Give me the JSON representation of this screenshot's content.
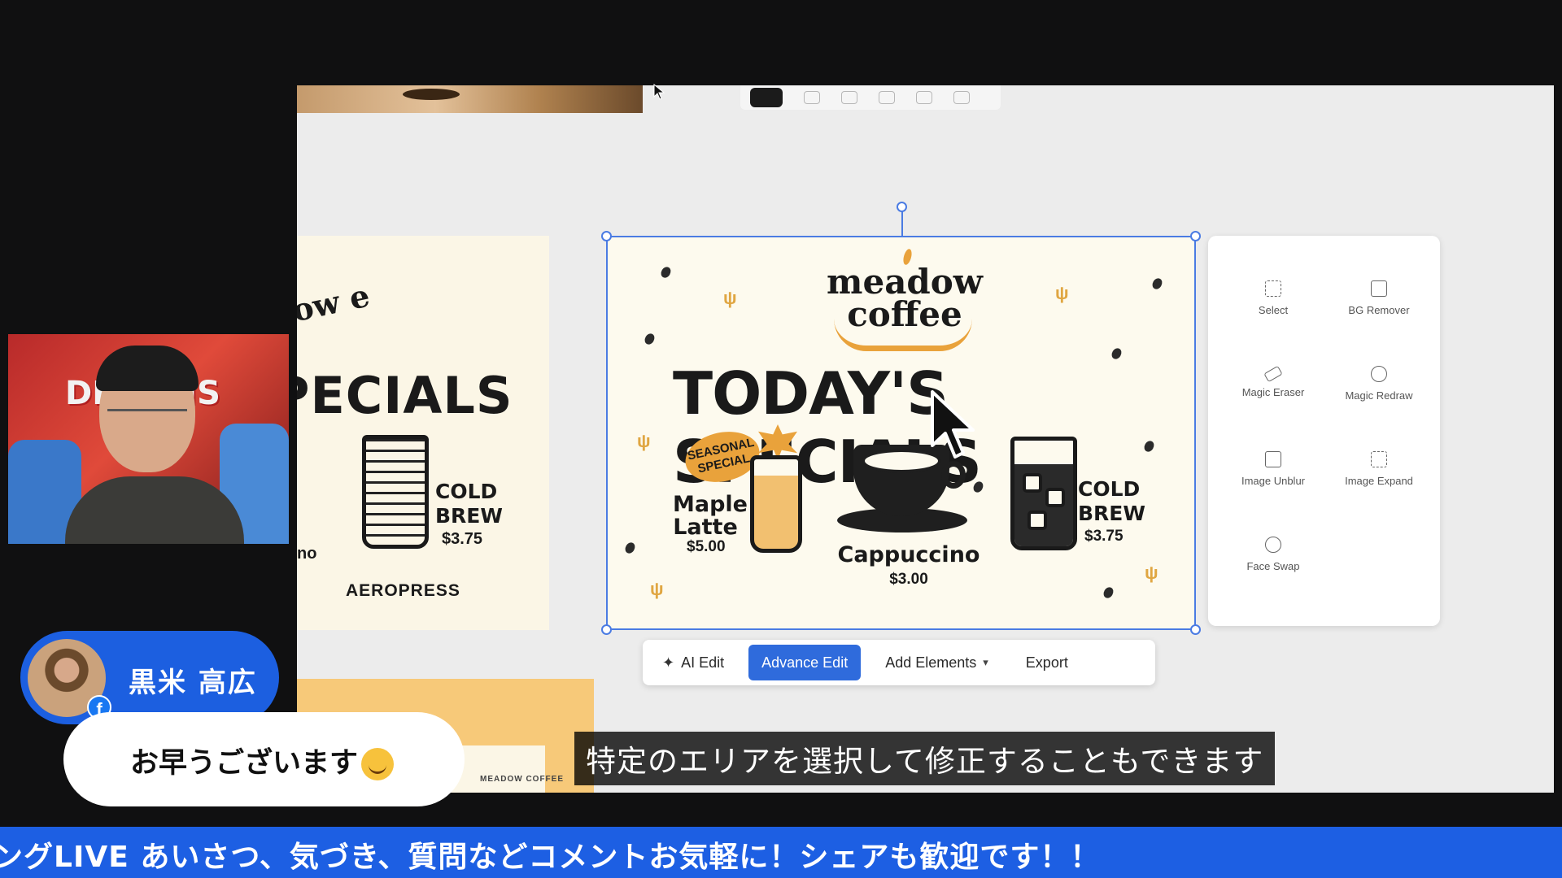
{
  "toolbar_top": {
    "buttons": [
      "pointer",
      "hand",
      "zoom-in",
      "zoom-out",
      "frame",
      "layers"
    ]
  },
  "left_card": {
    "script_text": "ow e",
    "title": "PECIALS",
    "item_name": "COLD BREW",
    "item_price": "$3.75",
    "footer": "AEROPRESS",
    "partial": "no"
  },
  "main_card": {
    "brand_line1": "meadow",
    "brand_line2": "coffee",
    "title": "TODAY'S SPECIALS",
    "seasonal_badge": "SEASONAL SPECIAL",
    "latte_name": "Maple Latte",
    "latte_price": "$5.00",
    "cappuccino_name": "Cappuccino",
    "cappuccino_price": "$3.00",
    "cold_name": "COLD BREW",
    "cold_price": "$3.75"
  },
  "tool_panel": {
    "tools": [
      {
        "label": "Select",
        "icon": "select-icon"
      },
      {
        "label": "BG Remover",
        "icon": "bg-remover-icon"
      },
      {
        "label": "Magic Eraser",
        "icon": "eraser-icon"
      },
      {
        "label": "Magic Redraw",
        "icon": "redraw-icon"
      },
      {
        "label": "Image Unblur",
        "icon": "unblur-icon"
      },
      {
        "label": "Image Expand",
        "icon": "expand-icon"
      },
      {
        "label": "Face Swap",
        "icon": "face-swap-icon"
      }
    ]
  },
  "action_bar": {
    "ai_edit": "AI Edit",
    "advance_edit": "Advance Edit",
    "add_elements": "Add Elements",
    "export": "Export"
  },
  "lower_card": {
    "label": "MEADOW COFFEE"
  },
  "subtitle": "特定のエリアを選択して修正することもできます",
  "webcam": {
    "overlay_text": "DREAMS"
  },
  "presenter": {
    "name": "黒米 高広",
    "platform_icon": "facebook-icon"
  },
  "comment": {
    "text": "お早うございます",
    "emoji": "smile-emoji"
  },
  "ticker": {
    "text": "ングLIVE あいさつ、気づき、質問などコメントお気軽に！シェアも歓迎です！！"
  },
  "colors": {
    "accent_blue": "#1d5fe3",
    "selection": "#4a7be3",
    "orange": "#e9a23b",
    "button_primary": "#2f6bdc"
  }
}
